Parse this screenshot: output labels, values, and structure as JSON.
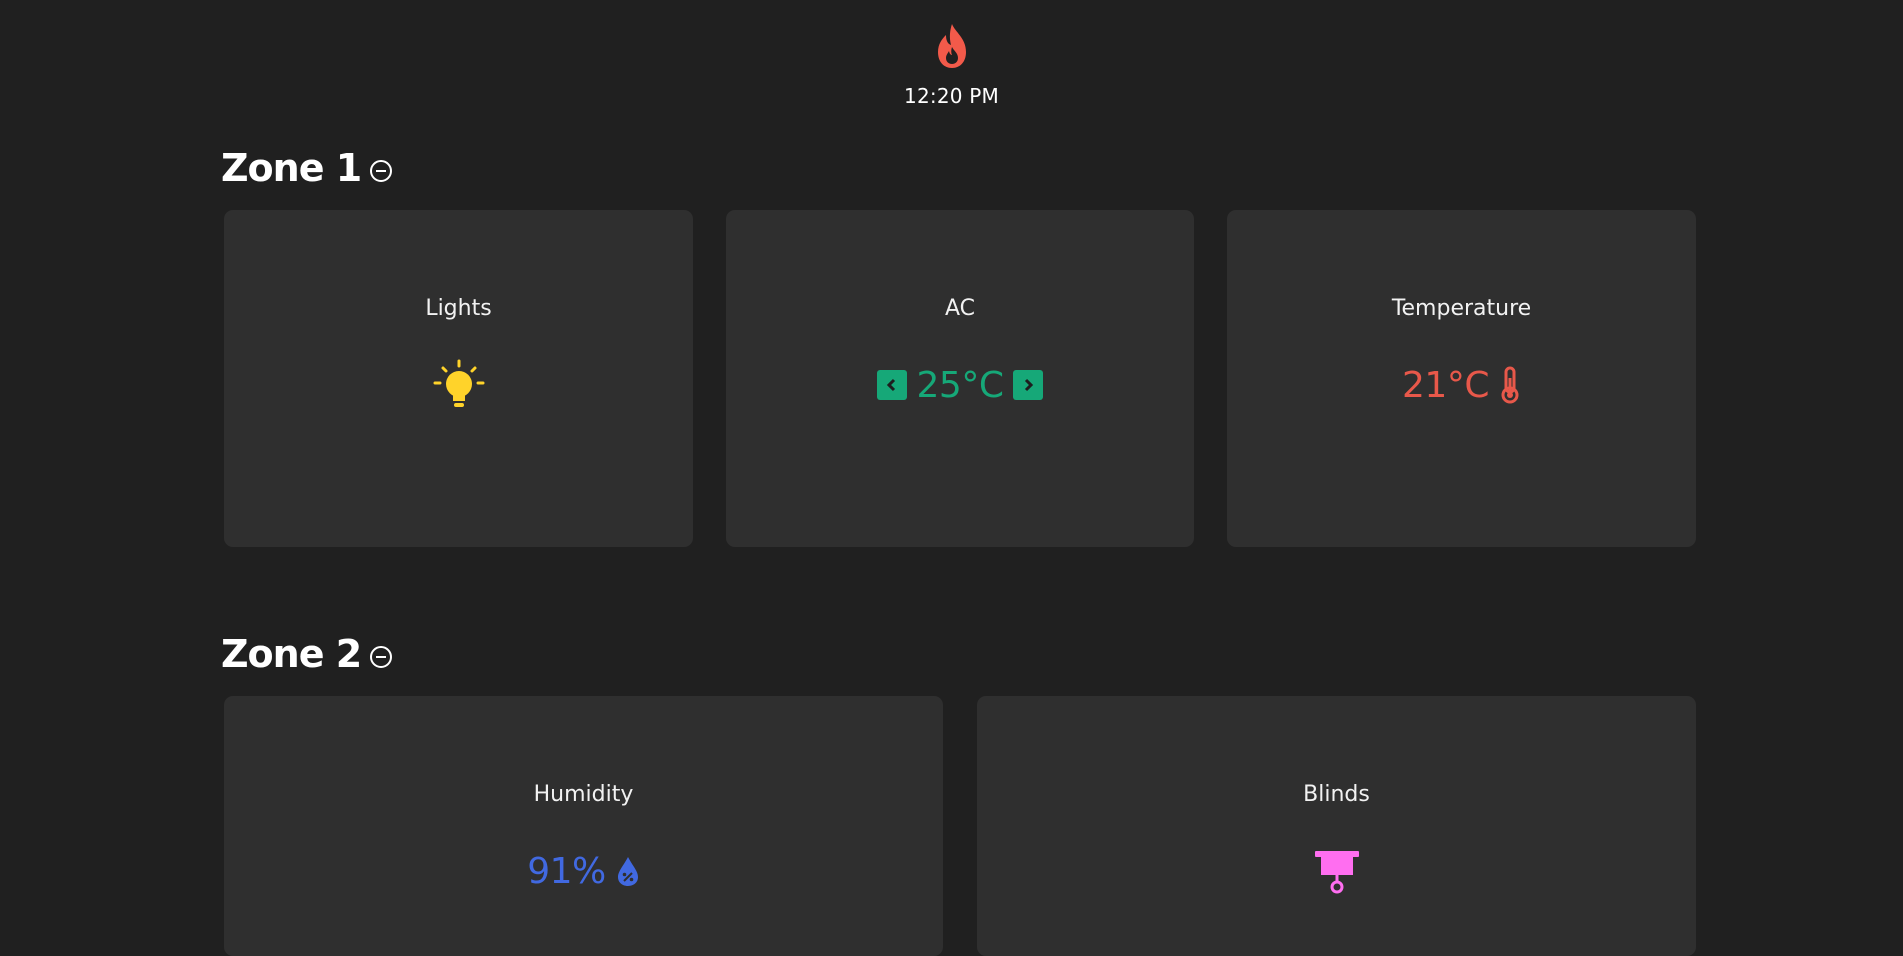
{
  "header": {
    "logo_icon": "flame-icon",
    "time": "12:20 PM"
  },
  "zones": [
    {
      "title": "Zone 1",
      "toggle_icon": "minus-circle-icon",
      "cards": {
        "lights": {
          "label": "Lights",
          "icon": "lightbulb-icon",
          "icon_color": "#ffd32a"
        },
        "ac": {
          "label": "AC",
          "value": "25°C",
          "color": "#16a878",
          "decrease_icon": "chevron-left-icon",
          "increase_icon": "chevron-right-icon"
        },
        "temperature": {
          "label": "Temperature",
          "value": "21°C",
          "color": "#e8584a",
          "icon": "thermometer-icon"
        }
      }
    },
    {
      "title": "Zone 2",
      "toggle_icon": "minus-circle-icon",
      "cards": {
        "humidity": {
          "label": "Humidity",
          "value": "91%",
          "color": "#4169e1",
          "icon": "water-drop-percent-icon"
        },
        "blinds": {
          "label": "Blinds",
          "icon": "blinds-icon",
          "icon_color": "#ff6ef0"
        }
      }
    }
  ],
  "colors": {
    "background": "#202020",
    "card": "#2f2f2f",
    "flame": "#f25a4a"
  }
}
